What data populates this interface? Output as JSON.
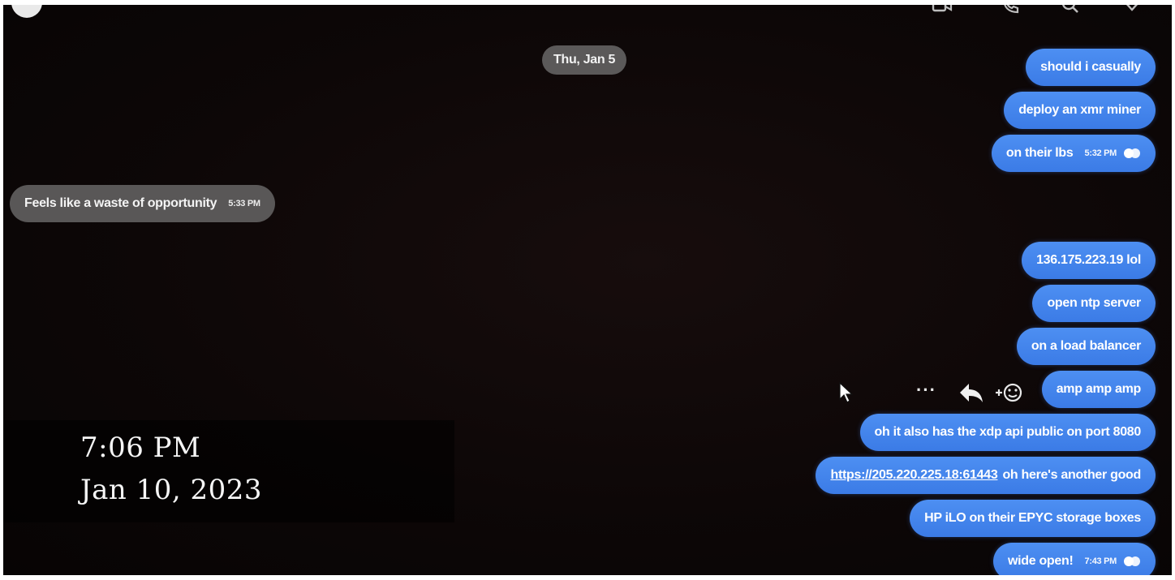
{
  "header": {
    "icons": [
      "video-camera-icon",
      "phone-icon",
      "search-icon",
      "info-icon"
    ]
  },
  "date_separator": "Thu, Jan 5",
  "messages": [
    {
      "direction": "out",
      "text": "should i casually"
    },
    {
      "direction": "out",
      "text": "deploy an xmr miner"
    },
    {
      "direction": "out",
      "text": "on their lbs",
      "time": "5:32 PM"
    },
    {
      "direction": "in",
      "text": "Feels like a waste of opportunity",
      "time": "5:33 PM"
    },
    {
      "direction": "out",
      "text": "136.175.223.19 lol"
    },
    {
      "direction": "out",
      "text": "open ntp server"
    },
    {
      "direction": "out",
      "text": "on a load balancer"
    },
    {
      "direction": "out",
      "text": "amp amp amp"
    },
    {
      "direction": "out",
      "text": "oh it also has the xdp api public on port 8080"
    },
    {
      "direction": "out",
      "link": "https://205.220.225.18:61443",
      "text": "oh here's another good"
    },
    {
      "direction": "out",
      "text": "HP iLO on their EPYC storage boxes"
    },
    {
      "direction": "out",
      "text": "wide open!",
      "time": "7:43 PM"
    }
  ],
  "message_actions": {
    "more": "···"
  },
  "overlay": {
    "time": "7:06 PM",
    "date": "Jan 10, 2023"
  },
  "colors": {
    "outgoing_bubble": "#3b7be6",
    "incoming_bubble": "#595757",
    "background": "#0d0707"
  }
}
